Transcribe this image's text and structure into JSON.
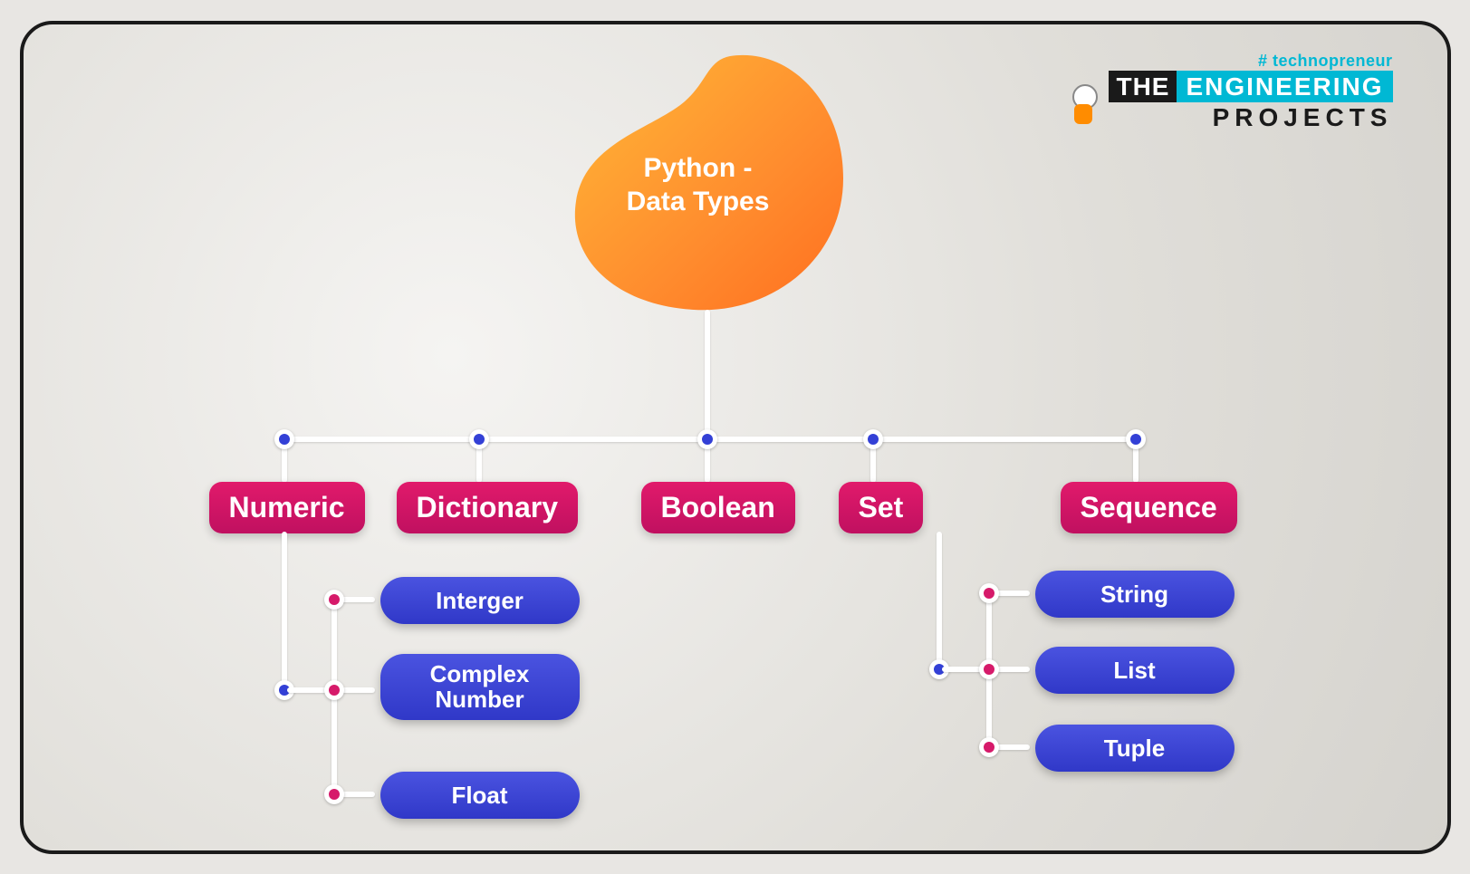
{
  "logo": {
    "tag": "# technopreneur",
    "the": "THE",
    "eng": "ENGINEERING",
    "proj": "PROJECTS"
  },
  "root": {
    "line1": "Python -",
    "line2": "Data Types"
  },
  "categories": [
    {
      "id": "numeric",
      "label": "Numeric"
    },
    {
      "id": "dictionary",
      "label": "Dictionary"
    },
    {
      "id": "boolean",
      "label": "Boolean"
    },
    {
      "id": "set",
      "label": "Set"
    },
    {
      "id": "sequence",
      "label": "Sequence"
    }
  ],
  "numeric_children": [
    {
      "id": "integer",
      "label": "Interger"
    },
    {
      "id": "complex",
      "label": "Complex Number"
    },
    {
      "id": "float",
      "label": "Float"
    }
  ],
  "sequence_children": [
    {
      "id": "string",
      "label": "String"
    },
    {
      "id": "list",
      "label": "List"
    },
    {
      "id": "tuple",
      "label": "Tuple"
    }
  ]
}
